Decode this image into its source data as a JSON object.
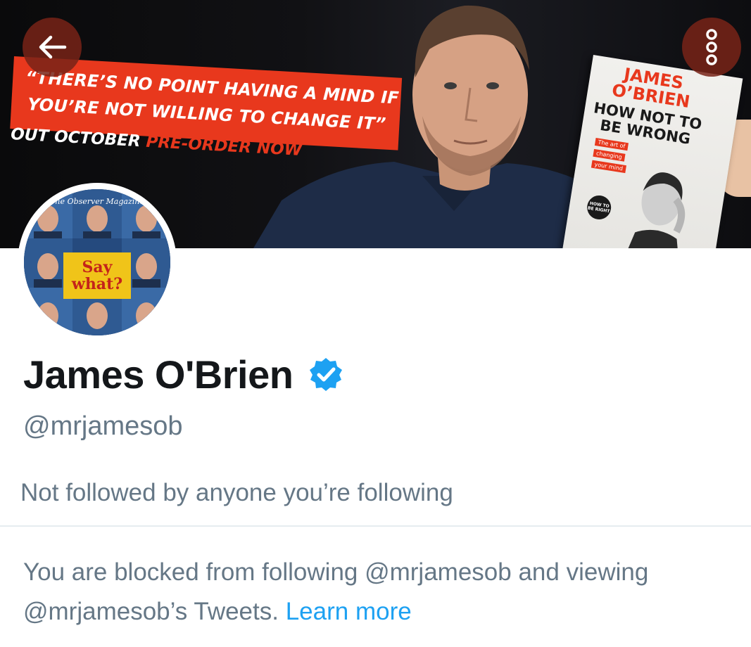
{
  "banner": {
    "quote_line1": "“THERE’S NO POINT HAVING A MIND IF",
    "quote_line2": "YOU’RE NOT WILLING TO CHANGE IT”",
    "release_text": "OUT OCTOBER",
    "preorder_text": "PRE-ORDER NOW",
    "book": {
      "author_line1": "JAMES",
      "author_line2": "O’BRIEN",
      "title_line1": "HOW NOT TO",
      "title_line2": "BE WRONG",
      "tag1": "The art of",
      "tag2": "changing",
      "tag3": "your mind",
      "badge": "HOW TO BE RIGHT"
    }
  },
  "header": {
    "back_icon": "arrow-left-icon",
    "more_icon": "more-vertical-icon"
  },
  "avatar": {
    "masthead": "The Observer Magazine",
    "cover_line1": "Say",
    "cover_line2": "what?"
  },
  "profile": {
    "name": "James O'Brien",
    "verified_icon": "verified-badge-icon",
    "handle": "@mrjamesob",
    "followed_by": "Not followed by anyone you’re following"
  },
  "blocked": {
    "message": "You are blocked from following @mrjamesob and viewing @mrjamesob’s Tweets. ",
    "link": "Learn more"
  },
  "colors": {
    "accent": "#1da1f2",
    "secondary_text": "#657786",
    "primary_text": "#14171a",
    "banner_red": "#e8381d"
  }
}
